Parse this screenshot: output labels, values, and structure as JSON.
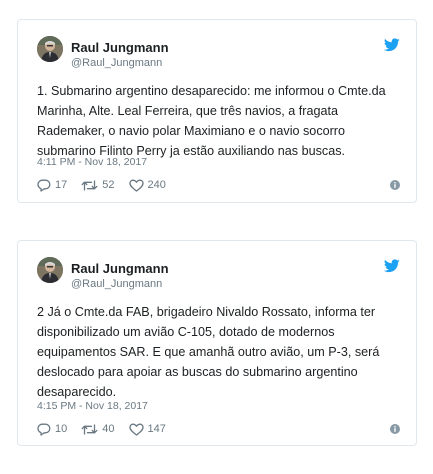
{
  "colors": {
    "text": "#1c2022",
    "muted": "#697882",
    "twitter_blue": "#1da1f2",
    "border": "#e1e8ed"
  },
  "tweets": [
    {
      "user_name": "Raul Jungmann",
      "user_handle": "@Raul_Jungmann",
      "text": "1. Submarino argentino desaparecido: me informou o Cmte.da Marinha, Alte. Leal Ferreira, que três navios, a fragata Rademaker, o navio polar Maximiano e o navio socorro submarino Filinto Perry ja estão auxiliando nas buscas.",
      "timestamp": "4:11 PM - Nov 18, 2017",
      "replies": "17",
      "retweets": "52",
      "likes": "240",
      "icons": [
        "twitter-bird-icon",
        "reply-icon",
        "retweet-icon",
        "like-icon",
        "info-icon"
      ]
    },
    {
      "user_name": "Raul Jungmann",
      "user_handle": "@Raul_Jungmann",
      "text": "2 Já o Cmte.da FAB, brigadeiro Nivaldo Rossato, informa ter disponibilizado um avião C-105, dotado de modernos equipamentos SAR. E que amanhã outro avião, um P-3, será deslocado para apoiar as buscas do submarino argentino desaparecido.",
      "timestamp": "4:15 PM - Nov 18, 2017",
      "replies": "10",
      "retweets": "40",
      "likes": "147",
      "icons": [
        "twitter-bird-icon",
        "reply-icon",
        "retweet-icon",
        "like-icon",
        "info-icon"
      ]
    }
  ]
}
